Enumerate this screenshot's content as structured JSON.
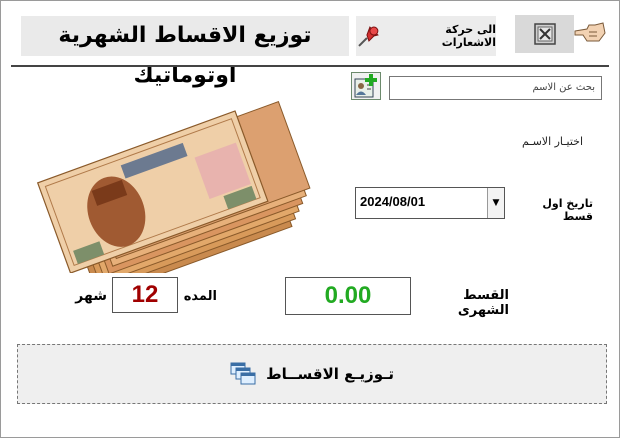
{
  "header": {
    "title": "توزيع الاقساط الشهرية اوتوماتيك",
    "notifications_button": "الى حركة الاشعارات"
  },
  "search": {
    "placeholder": "بحث عن الاسم"
  },
  "form": {
    "select_name_label": "اختيـار الاسـم",
    "first_installment_date_label": "تاريخ اول قسط",
    "first_installment_date_value": "2024/08/01",
    "monthly_installment_label": "القسط الشهرى",
    "monthly_installment_value": "0.00",
    "period_label": "المده",
    "period_value": "12",
    "period_unit": "شهر"
  },
  "actions": {
    "distribute_label": "تـوزيـع الاقســاط"
  },
  "colors": {
    "installment_value": "#22aa22",
    "period_value": "#a00000",
    "panel": "#eaeaea"
  },
  "icons": [
    "pushpin-icon",
    "close-window-icon",
    "pointing-hand-icon",
    "add-user-icon",
    "money-banknotes-image",
    "windows-stack-icon",
    "dropdown-arrow-icon"
  ]
}
